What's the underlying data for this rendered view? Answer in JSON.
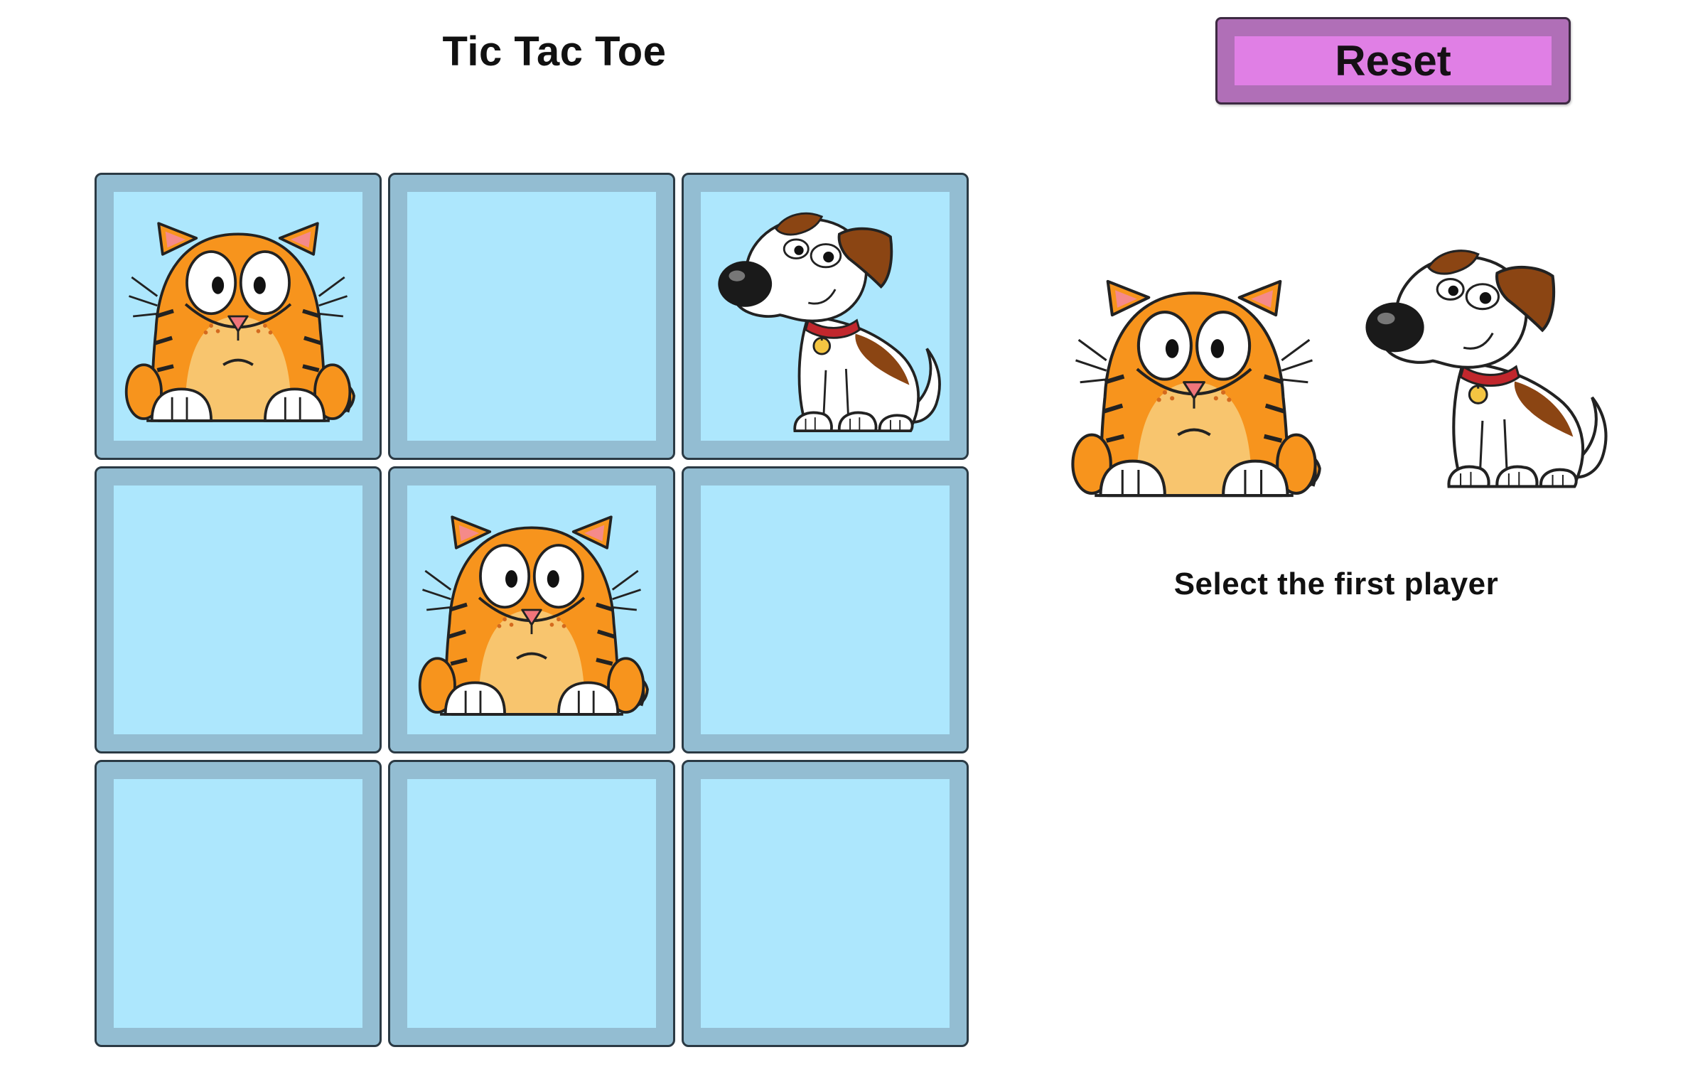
{
  "game": {
    "title": "Tic Tac Toe",
    "reset_label": "Reset",
    "prompt": "Select the first player",
    "players": [
      "cat",
      "dog"
    ],
    "board": [
      [
        "cat",
        "",
        "dog"
      ],
      [
        "",
        "cat",
        ""
      ],
      [
        "",
        "",
        ""
      ]
    ]
  },
  "icons": {
    "cat": "cat-icon",
    "dog": "dog-icon"
  },
  "colors": {
    "cell_border": "#93bdd2",
    "cell_face": "#ade7fd",
    "button_outer": "#b06fb7",
    "button_inner": "#e07fe5",
    "cat_orange": "#f7941d",
    "cat_belly": "#f8c56e",
    "dog_brown": "#8b4513",
    "dog_collar": "#c1272d"
  }
}
